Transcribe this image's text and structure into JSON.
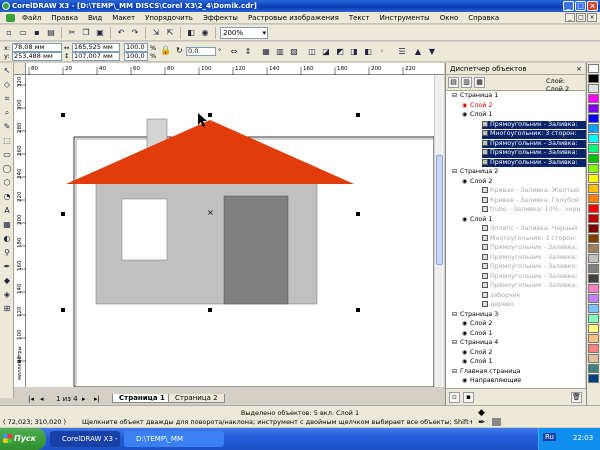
{
  "window": {
    "title": "CorelDRAW X3 - [D:\\TEMP\\_MM DISCS\\Corel X3\\2_4\\Domik.cdr]",
    "controls": [
      "_",
      "□",
      "×"
    ]
  },
  "menubar": {
    "items": [
      "Файл",
      "Правка",
      "Вид",
      "Макет",
      "Упорядочить",
      "Эффекты",
      "Растровые изображения",
      "Текст",
      "Инструменты",
      "Окно",
      "Справка"
    ]
  },
  "toolbar": {
    "zoom_value": "200%"
  },
  "property_bar": {
    "x_label": "x:",
    "x_value": "78,08 мм",
    "y_label": "y:",
    "y_value": "253,488 мм",
    "w_value": "165,525 мм",
    "h_value": "107,007 мм",
    "scale_w": "100,0",
    "scale_h": "100,0",
    "angle_value": "0,0"
  },
  "rulers": {
    "top_ticks": [
      "80",
      "20",
      "40",
      "60",
      "80",
      "100",
      "120",
      "140",
      "160",
      "180",
      "200",
      "220"
    ],
    "left_ticks": [
      "320",
      "300",
      "280",
      "260",
      "240",
      "220",
      "200",
      "180",
      "160",
      "140",
      "120",
      "100",
      "80"
    ],
    "unit": "миллиметры"
  },
  "pages": {
    "counter": "1 из 4",
    "tabs": [
      "Страница 1",
      "Страница 2"
    ]
  },
  "docker": {
    "title": "Диспетчер объектов",
    "layer_info_line1": "Слой:",
    "layer_info_line2": "Слой 2",
    "tree": [
      {
        "text": "Страница 1",
        "style": "normal"
      },
      {
        "text": "Слой 2",
        "style": "red"
      },
      {
        "text": "Слой 1",
        "style": "normal"
      },
      {
        "text": "Прямоугольник - Заливка:",
        "style": "sel"
      },
      {
        "text": "Многоугольник: 3 сторон:",
        "style": "sel"
      },
      {
        "text": "Прямоугольник - Заливка:",
        "style": "sel"
      },
      {
        "text": "Прямоугольник - Заливка:",
        "style": "sel"
      },
      {
        "text": "Прямоугольник - Заливка:",
        "style": "sel"
      },
      {
        "text": "Страница 2",
        "style": "normal"
      },
      {
        "text": "Слой 2",
        "style": "normal"
      },
      {
        "text": "Кривая - Заливка: Желтый",
        "style": "gray"
      },
      {
        "text": "Кривая - Заливка: Голубой",
        "style": "gray"
      },
      {
        "text": "trubo - Заливка: 10% - черн",
        "style": "gray"
      },
      {
        "text": "Слой 1",
        "style": "normal"
      },
      {
        "text": "Эллипс - Заливка: Черный",
        "style": "gray"
      },
      {
        "text": "Многоугольник: 3 сторон:",
        "style": "gray"
      },
      {
        "text": "Прямоугольник - Заливка:",
        "style": "gray"
      },
      {
        "text": "Прямоугольник - Заливка:",
        "style": "gray"
      },
      {
        "text": "Прямоугольник - Заливка:",
        "style": "gray"
      },
      {
        "text": "Прямоугольник - Заливка:",
        "style": "gray"
      },
      {
        "text": "Прямоугольник - Заливка:",
        "style": "gray"
      },
      {
        "text": "заборчик",
        "style": "gray"
      },
      {
        "text": "дерево",
        "style": "gray"
      },
      {
        "text": "Страница 3",
        "style": "normal"
      },
      {
        "text": "Слой 2",
        "style": "normal"
      },
      {
        "text": "Слой 1",
        "style": "normal"
      },
      {
        "text": "Страница 4",
        "style": "normal"
      },
      {
        "text": "Слой 2",
        "style": "normal"
      },
      {
        "text": "Слой 1",
        "style": "normal"
      },
      {
        "text": "Главная страница",
        "style": "normal"
      },
      {
        "text": "Направляющие",
        "style": "normal"
      }
    ]
  },
  "status": {
    "selection": "Выделено объектов: 5 вкл. Слой 1",
    "coords": "( 72,023; 310,020 )",
    "hint": "Щелкните объект дважды для поворота/наклона; инструмент с двойным щелчком выбирает все объекты; Shift+щелчок - выбор не..."
  },
  "taskbar": {
    "start_label": "Пуск",
    "tasks": [
      "CorelDRAW X3 - [D:\\...",
      "D:\\TEMP\\_MM DISCS\\Corel X3"
    ],
    "lang": "Ru",
    "clock": "22:03"
  },
  "drawing": {
    "roof_color": "#e23c0a",
    "wall_color": "#c0c0c0",
    "door_color": "#808080",
    "chimney_color": "#d4d4d4",
    "window_color": "#ffffff"
  },
  "palette_colors": [
    "#ffffff",
    "#000000",
    "#e0e0e0",
    "#ff00ff",
    "#8000ff",
    "#0000ff",
    "#00a0ff",
    "#00ffff",
    "#00ff80",
    "#00c000",
    "#80ff00",
    "#ffff00",
    "#ffc000",
    "#ff8000",
    "#ff0000",
    "#c00000",
    "#800000",
    "#804000",
    "#a08060",
    "#c0c0c0",
    "#808080",
    "#404040",
    "#ff80c0",
    "#c080ff",
    "#80c0ff",
    "#80ffc0",
    "#ffff80",
    "#ffc080",
    "#ff8080",
    "#e0c0a0",
    "#408080",
    "#004080"
  ]
}
